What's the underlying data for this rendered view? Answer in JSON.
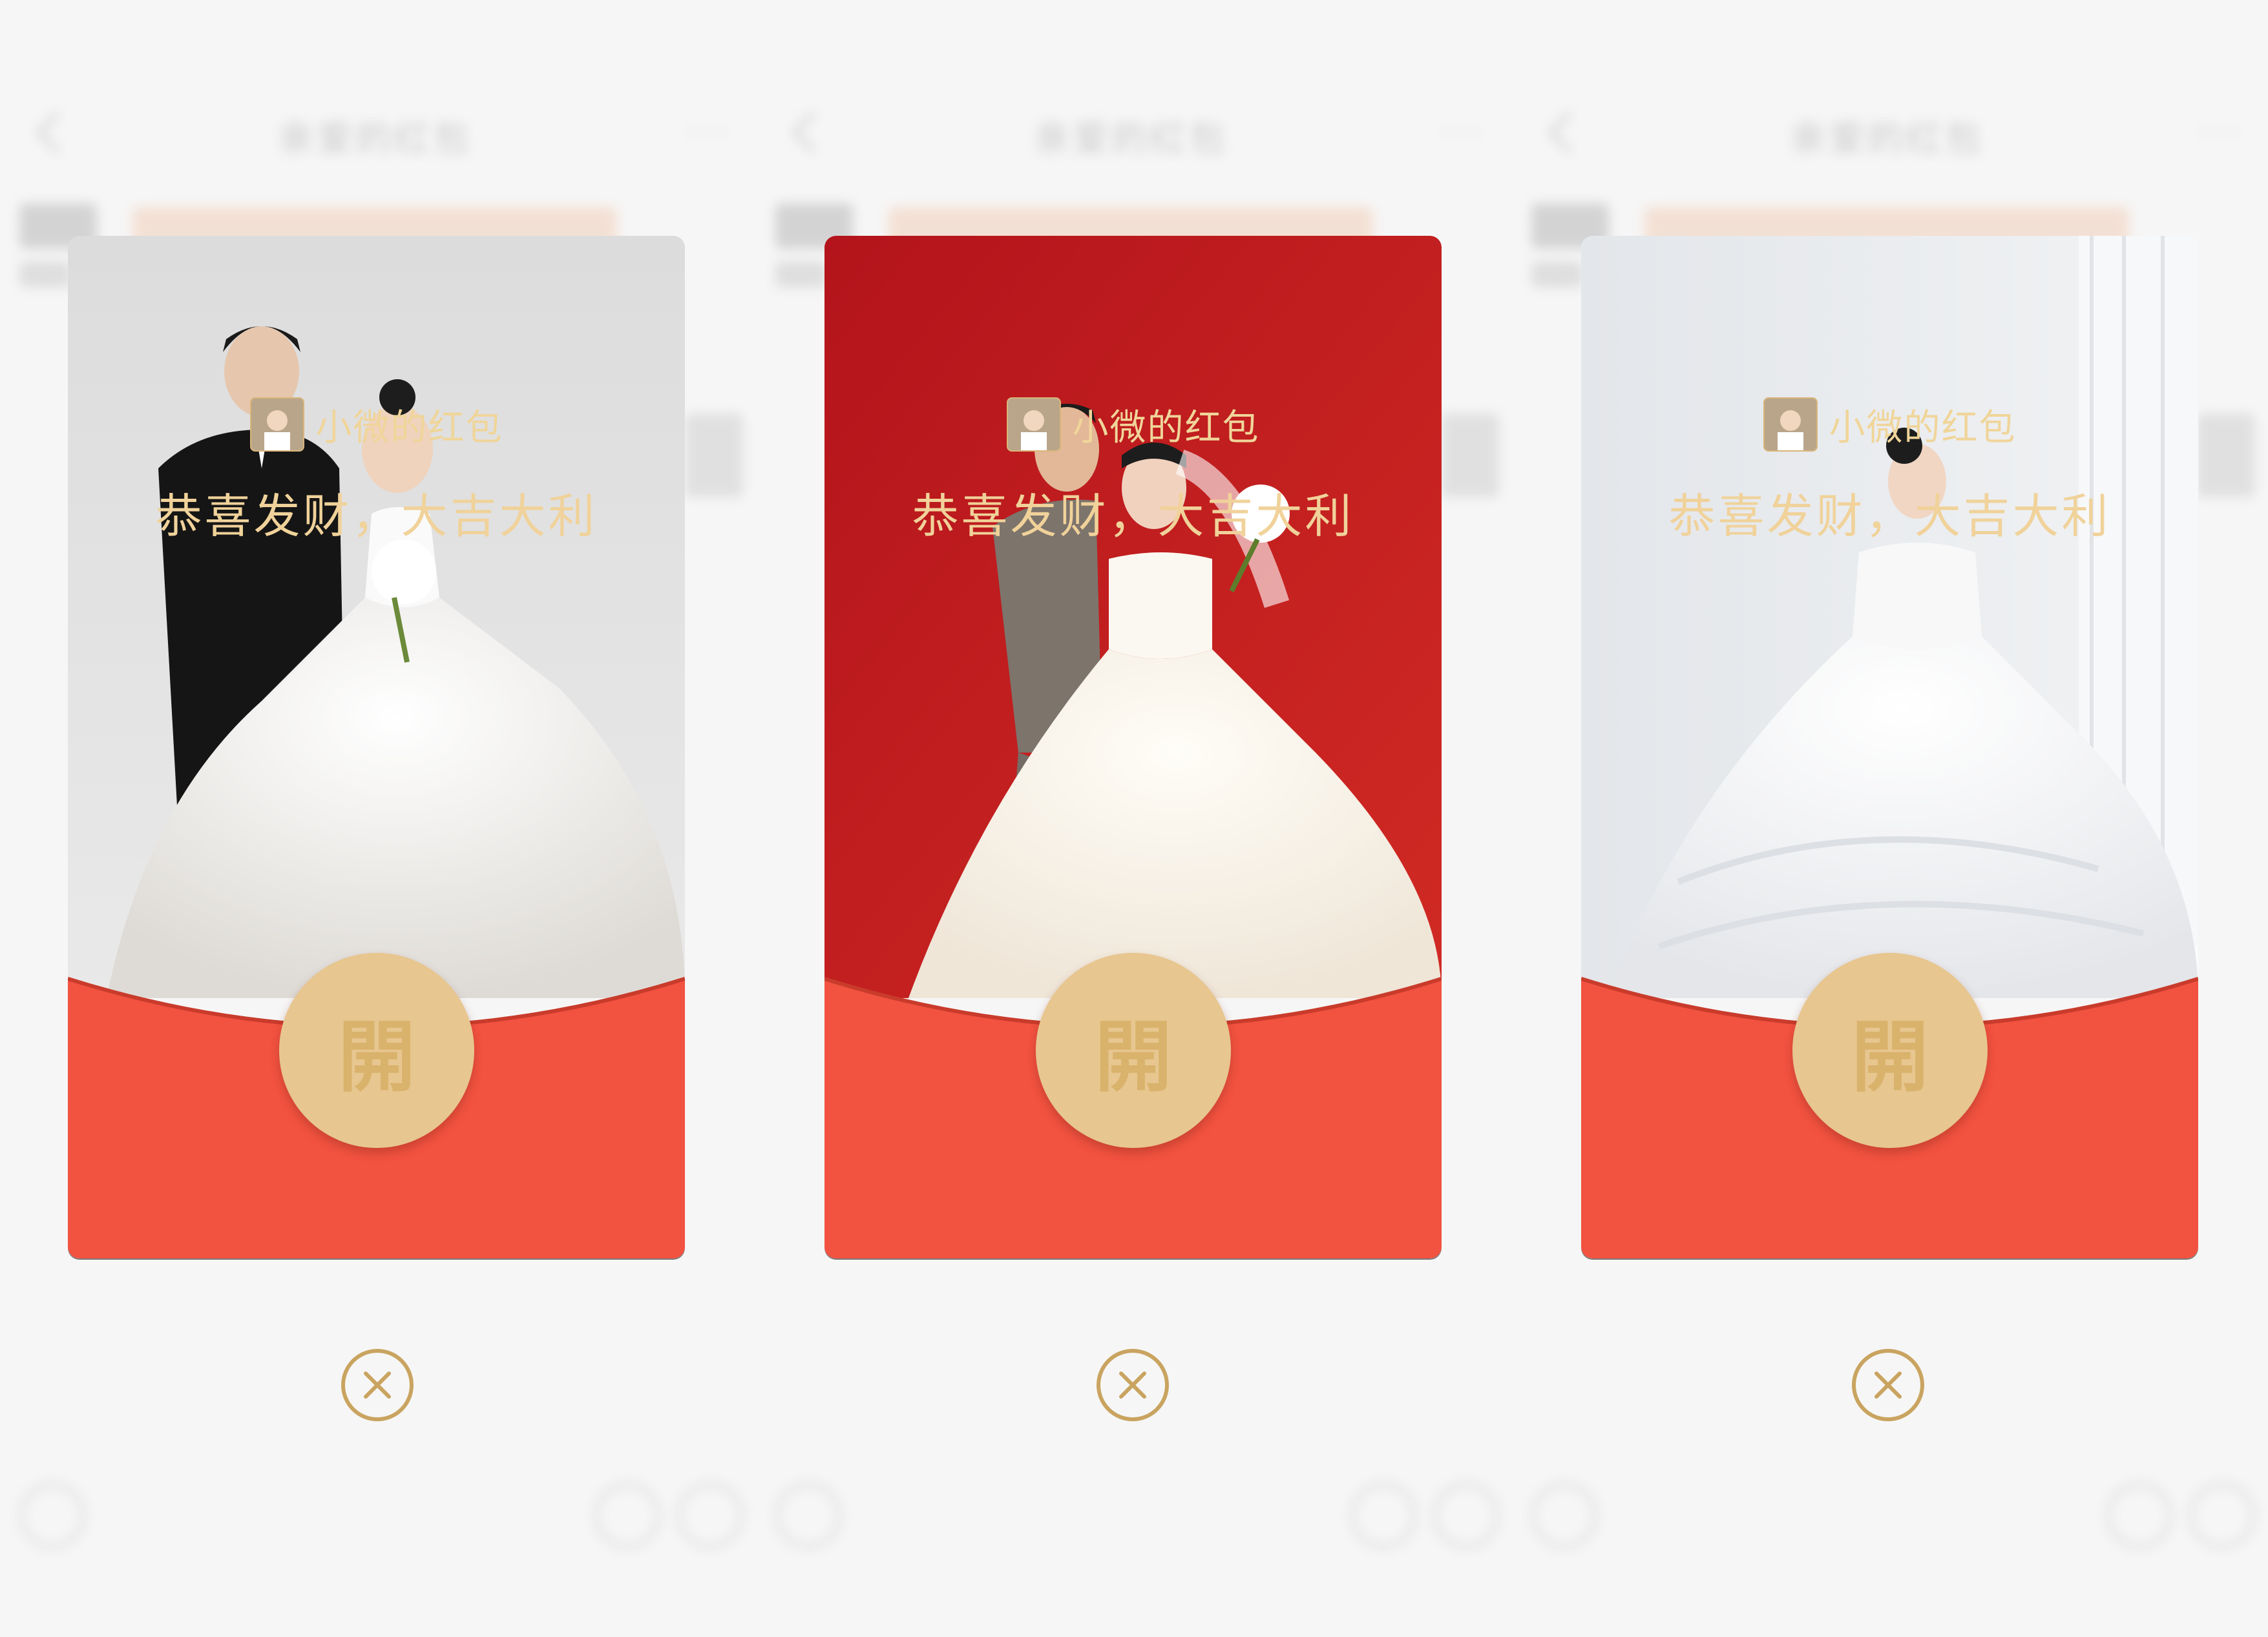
{
  "background": {
    "chat_title": "亲爱的红包",
    "more_label": "···"
  },
  "envelopes": [
    {
      "sender": "小微的红包",
      "greeting": "恭喜发财，大吉大利",
      "open_label": "開"
    },
    {
      "sender": "小微的红包",
      "greeting": "恭喜发财，大吉大利",
      "open_label": "開"
    },
    {
      "sender": "小微的红包",
      "greeting": "恭喜发财，大吉大利",
      "open_label": "開"
    }
  ],
  "icons": {
    "close": "close-icon",
    "back": "back-arrow-icon",
    "avatar": "avatar-image",
    "photo": "wedding-photo"
  },
  "colors": {
    "envelope_red": "#f25240",
    "open_button_gold": "#e7c68f",
    "greeting_gold": "#f0d29a",
    "close_ring": "#c9a460",
    "page_bg": "#f6f6f6"
  }
}
